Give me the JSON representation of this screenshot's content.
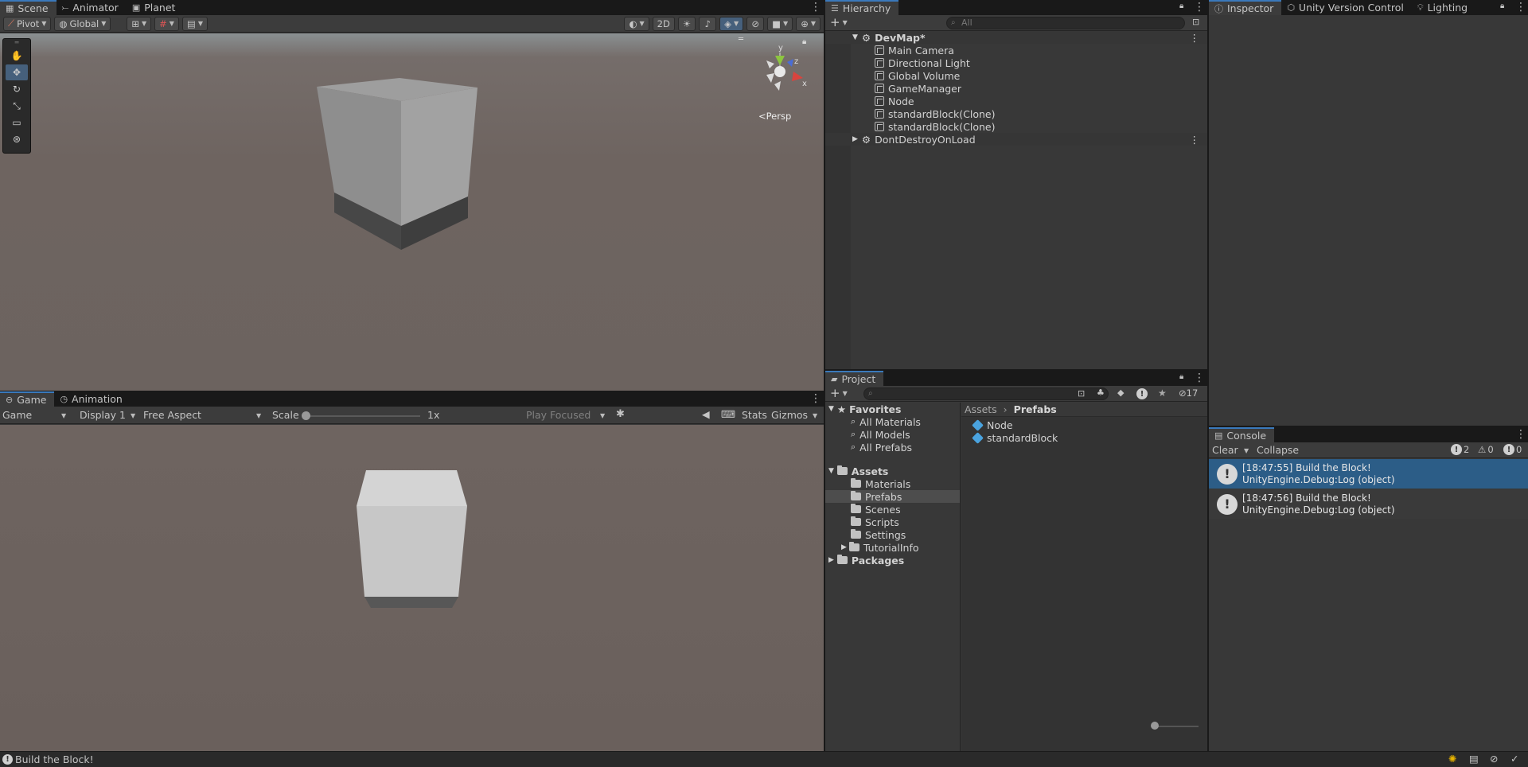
{
  "scene_panel": {
    "tabs": [
      {
        "label": "Scene",
        "icon": "scene-grid-icon"
      },
      {
        "label": "Animator",
        "icon": "animator-icon"
      },
      {
        "label": "Planet",
        "icon": "planet-icon"
      }
    ],
    "toolbar": {
      "pivot": "Pivot",
      "global": "Global",
      "mode_2d": "2D"
    },
    "gizmo": {
      "y": "y",
      "z": "z",
      "x": "x",
      "projection": "Persp"
    }
  },
  "game_panel": {
    "tabs": [
      {
        "label": "Game",
        "icon": "gamepad-icon"
      },
      {
        "label": "Animation",
        "icon": "clock-icon"
      }
    ],
    "toolbar": {
      "view": "Game",
      "display": "Display 1",
      "aspect": "Free Aspect",
      "scale_label": "Scale",
      "scale_value": "1x",
      "play_focus": "Play Focused",
      "stats": "Stats",
      "gizmos": "Gizmos"
    }
  },
  "hierarchy": {
    "tab": "Hierarchy",
    "search_placeholder": "All",
    "scenes": [
      {
        "name": "DevMap*",
        "items": [
          "Main Camera",
          "Directional Light",
          "Global Volume",
          "GameManager",
          "Node",
          "standardBlock(Clone)",
          "standardBlock(Clone)"
        ]
      },
      {
        "name": "DontDestroyOnLoad",
        "items": []
      }
    ]
  },
  "inspector": {
    "tabs": [
      {
        "label": "Inspector",
        "icon": "info-icon"
      },
      {
        "label": "Unity Version Control",
        "icon": "version-control-icon"
      },
      {
        "label": "Lighting",
        "icon": "bulb-icon"
      }
    ]
  },
  "project": {
    "tab": "Project",
    "hidden_count": "17",
    "favorites_label": "Favorites",
    "favorites": [
      "All Materials",
      "All Models",
      "All Prefabs"
    ],
    "assets_label": "Assets",
    "folders": [
      "Materials",
      "Prefabs",
      "Scenes",
      "Scripts",
      "Settings",
      "TutorialInfo"
    ],
    "selected_folder": "Prefabs",
    "packages_label": "Packages",
    "breadcrumb": [
      "Assets",
      "Prefabs"
    ],
    "files": [
      "Node",
      "standardBlock"
    ]
  },
  "console": {
    "tab": "Console",
    "clear": "Clear",
    "collapse": "Collapse",
    "counts": {
      "logs": "2",
      "warnings": "0",
      "errors": "0"
    },
    "entries": [
      {
        "time_msg": "[18:47:55] Build the Block!",
        "source": "UnityEngine.Debug:Log (object)",
        "selected": true
      },
      {
        "time_msg": "[18:47:56] Build the Block!",
        "source": "UnityEngine.Debug:Log (object)",
        "selected": false
      }
    ]
  },
  "status_bar": {
    "message": "Build the Block!"
  }
}
